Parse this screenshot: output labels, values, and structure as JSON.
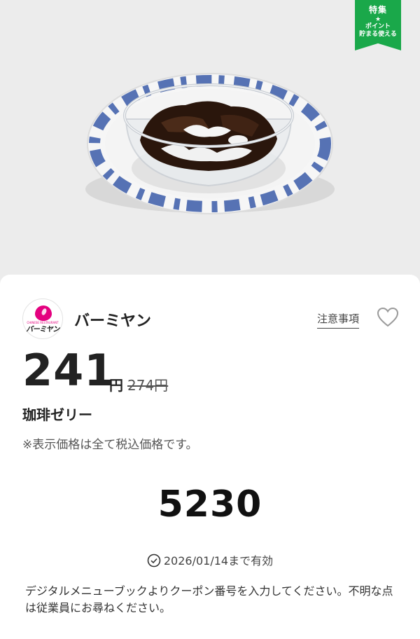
{
  "hero": {
    "image_alt": "Coffee jelly dessert in a glass bowl on a blue-patterned plate",
    "badge": {
      "line1": "特集",
      "star": "★",
      "line2": "ポイント",
      "line3": "貯まる使える",
      "color": "#1aa84a"
    }
  },
  "brand": {
    "name": "バーミヤン",
    "logo_text": "バーミヤン",
    "logo_sub": "CHINESE RESTAURANT",
    "logo_color": "#e4007f"
  },
  "header_actions": {
    "notice_label": "注意事項",
    "favorite_icon": "heart-icon"
  },
  "price": {
    "value": "241",
    "currency": "円",
    "original": "274円"
  },
  "product": {
    "name": "珈琲ゼリー"
  },
  "tax_note": "※表示価格は全て税込価格です。",
  "coupon": {
    "code": "5230",
    "validity_icon": "check-circle-icon",
    "validity": "2026/01/14まで有効",
    "instructions": "デジタルメニューブックよりクーポン番号を入力してください。不明な点は従業員にお尋ねください。"
  }
}
